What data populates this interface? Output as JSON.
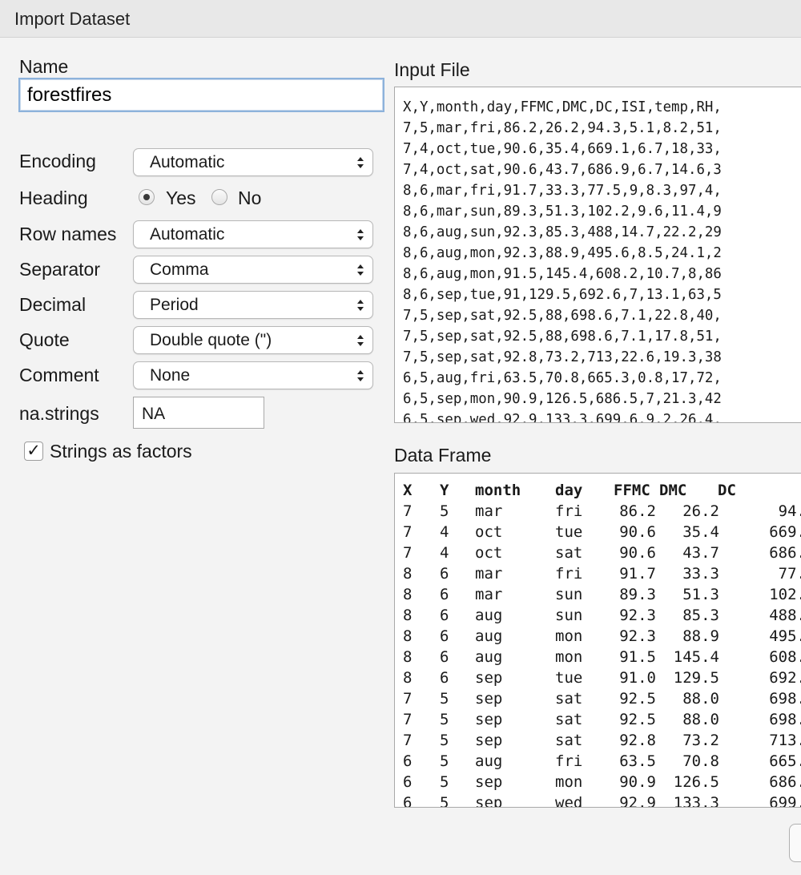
{
  "window": {
    "title": "Import Dataset"
  },
  "form": {
    "name_label": "Name",
    "name_value": "forestfires",
    "encoding_label": "Encoding",
    "encoding_value": "Automatic",
    "heading_label": "Heading",
    "heading_yes": "Yes",
    "heading_no": "No",
    "heading_selected": "Yes",
    "rownames_label": "Row names",
    "rownames_value": "Automatic",
    "separator_label": "Separator",
    "separator_value": "Comma",
    "decimal_label": "Decimal",
    "decimal_value": "Period",
    "quote_label": "Quote",
    "quote_value": "Double quote (\")",
    "comment_label": "Comment",
    "comment_value": "None",
    "na_label": "na.strings",
    "na_value": "NA",
    "factors_label": "Strings as factors",
    "factors_checked": true,
    "check_mark": "✓"
  },
  "input_file": {
    "label": "Input File",
    "lines": [
      "X,Y,month,day,FFMC,DMC,DC,ISI,temp,RH,",
      "7,5,mar,fri,86.2,26.2,94.3,5.1,8.2,51,",
      "7,4,oct,tue,90.6,35.4,669.1,6.7,18,33,",
      "7,4,oct,sat,90.6,43.7,686.9,6.7,14.6,3",
      "8,6,mar,fri,91.7,33.3,77.5,9,8.3,97,4,",
      "8,6,mar,sun,89.3,51.3,102.2,9.6,11.4,9",
      "8,6,aug,sun,92.3,85.3,488,14.7,22.2,29",
      "8,6,aug,mon,92.3,88.9,495.6,8.5,24.1,2",
      "8,6,aug,mon,91.5,145.4,608.2,10.7,8,86",
      "8,6,sep,tue,91,129.5,692.6,7,13.1,63,5",
      "7,5,sep,sat,92.5,88,698.6,7.1,22.8,40,",
      "7,5,sep,sat,92.5,88,698.6,7.1,17.8,51,",
      "7,5,sep,sat,92.8,73.2,713,22.6,19.3,38",
      "6,5,aug,fri,63.5,70.8,665.3,0.8,17,72,",
      "6,5,sep,mon,90.9,126.5,686.5,7,21.3,42",
      "6,5,sep,wed,92.9,133.3,699.6,9.2,26.4,"
    ]
  },
  "data_frame": {
    "label": "Data Frame",
    "columns": [
      "X",
      "Y",
      "month",
      "day",
      "FFMC",
      "DMC",
      "DC"
    ],
    "rows": [
      [
        "7",
        "5",
        "mar",
        "fri",
        "86.2",
        "26.2",
        "94."
      ],
      [
        "7",
        "4",
        "oct",
        "tue",
        "90.6",
        "35.4",
        "669."
      ],
      [
        "7",
        "4",
        "oct",
        "sat",
        "90.6",
        "43.7",
        "686."
      ],
      [
        "8",
        "6",
        "mar",
        "fri",
        "91.7",
        "33.3",
        "77."
      ],
      [
        "8",
        "6",
        "mar",
        "sun",
        "89.3",
        "51.3",
        "102."
      ],
      [
        "8",
        "6",
        "aug",
        "sun",
        "92.3",
        "85.3",
        "488."
      ],
      [
        "8",
        "6",
        "aug",
        "mon",
        "92.3",
        "88.9",
        "495."
      ],
      [
        "8",
        "6",
        "aug",
        "mon",
        "91.5",
        "145.4",
        "608."
      ],
      [
        "8",
        "6",
        "sep",
        "tue",
        "91.0",
        "129.5",
        "692."
      ],
      [
        "7",
        "5",
        "sep",
        "sat",
        "92.5",
        "88.0",
        "698."
      ],
      [
        "7",
        "5",
        "sep",
        "sat",
        "92.5",
        "88.0",
        "698."
      ],
      [
        "7",
        "5",
        "sep",
        "sat",
        "92.8",
        "73.2",
        "713."
      ],
      [
        "6",
        "5",
        "aug",
        "fri",
        "63.5",
        "70.8",
        "665."
      ],
      [
        "6",
        "5",
        "sep",
        "mon",
        "90.9",
        "126.5",
        "686."
      ],
      [
        "6",
        "5",
        "sep",
        "wed",
        "92.9",
        "133.3",
        "699."
      ]
    ]
  },
  "colors": {
    "window_bg": "#f3f3f3",
    "titlebar_bg": "#e8e8e8",
    "focus_ring": "#8db2db"
  }
}
